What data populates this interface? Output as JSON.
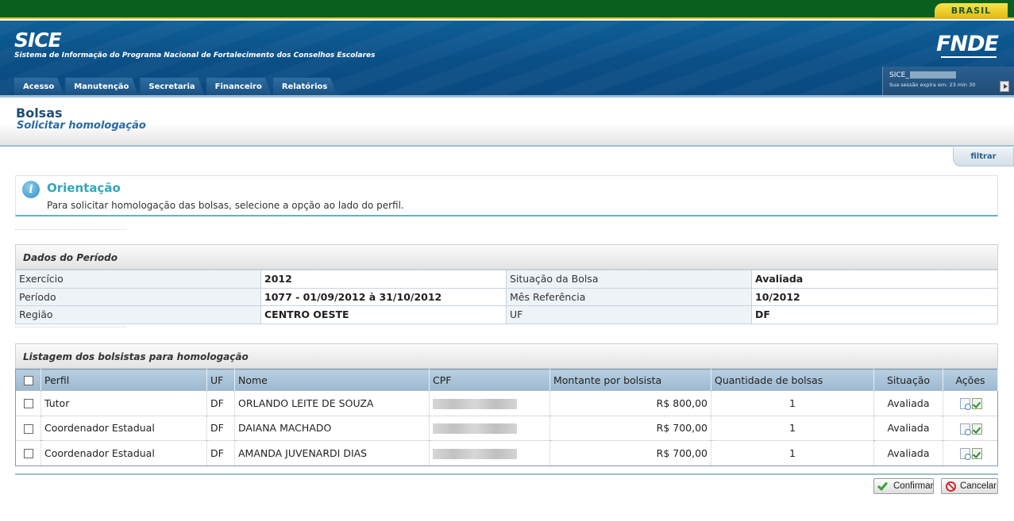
{
  "header": {
    "brasil_label": "BRASIL",
    "app_title": "SICE",
    "app_subtitle": "Sistema de Informação do Programa Nacional de Fortalecimento dos Conselhos Escolares",
    "org_logo_text": "FNDE"
  },
  "menu": {
    "tabs": [
      {
        "label": "Acesso"
      },
      {
        "label": "Manutenção"
      },
      {
        "label": "Secretaria"
      },
      {
        "label": "Financeiro"
      },
      {
        "label": "Relatórios"
      }
    ]
  },
  "session": {
    "user": "SICE_",
    "expire_text": "Sua sessão expira em: 23 min 30"
  },
  "page": {
    "title": "Bolsas",
    "subtitle": "Solicitar homologação",
    "filter_label": "filtrar"
  },
  "orientation": {
    "title": "Orientação",
    "text": "Para solicitar homologação das bolsas, selecione a opção ao lado do perfil."
  },
  "periodo": {
    "heading": "Dados do Período",
    "rows": [
      {
        "l1": "Exercício",
        "v1": "2012",
        "l2": "Situação da Bolsa",
        "v2": "Avaliada"
      },
      {
        "l1": "Período",
        "v1": "1077 - 01/09/2012 à 31/10/2012",
        "l2": "Mês Referência",
        "v2": "10/2012"
      },
      {
        "l1": "Região",
        "v1": "CENTRO OESTE",
        "l2": "UF",
        "v2": "DF"
      }
    ]
  },
  "listagem": {
    "heading": "Listagem dos bolsistas para homologação",
    "columns": {
      "perfil": "Perfil",
      "uf": "UF",
      "nome": "Nome",
      "cpf": "CPF",
      "montante": "Montante por bolsista",
      "quantidade": "Quantidade de bolsas",
      "situacao": "Situação",
      "acoes": "Ações"
    },
    "rows": [
      {
        "perfil": "Tutor",
        "uf": "DF",
        "nome": "ORLANDO LEITE DE SOUZA",
        "montante": "R$ 800,00",
        "quantidade": "1",
        "situacao": "Avaliada"
      },
      {
        "perfil": "Coordenador Estadual",
        "uf": "DF",
        "nome": "DAIANA MACHADO",
        "montante": "R$ 700,00",
        "quantidade": "1",
        "situacao": "Avaliada"
      },
      {
        "perfil": "Coordenador Estadual",
        "uf": "DF",
        "nome": "AMANDA JUVENARDI DIAS",
        "montante": "R$ 700,00",
        "quantidade": "1",
        "situacao": "Avaliada"
      }
    ]
  },
  "actions": {
    "confirm_label": "Confirmar",
    "cancel_label": "Cancelar"
  },
  "icons": {
    "info": "info-icon",
    "view": "view-document-icon",
    "homologate": "approve-document-icon",
    "confirm": "checkmark-icon",
    "cancel": "cancel-icon",
    "logout": "logout-icon"
  },
  "colors": {
    "gov_bar": "#0b5f1e",
    "banner": "#0f5e98",
    "table_header": "#b9cfe1",
    "orientation_title": "#33a6ba"
  }
}
